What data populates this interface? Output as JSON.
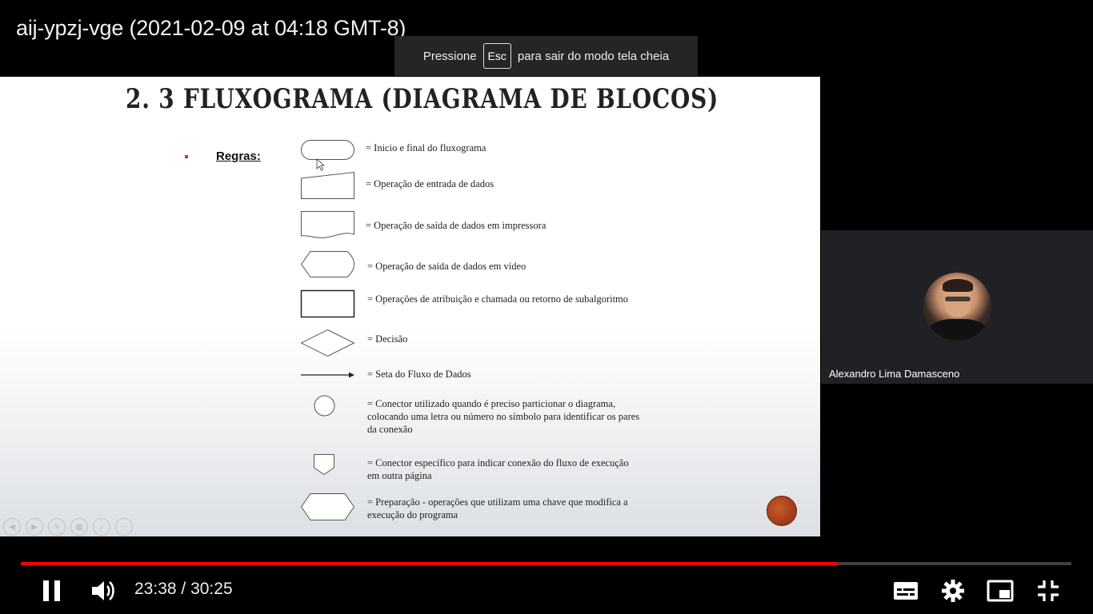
{
  "video": {
    "title": "aij-ypzj-vge (2021-02-09 at 04:18 GMT-8)"
  },
  "fullscreen_toast": {
    "prefix": "Pressione",
    "key": "Esc",
    "suffix": "para sair do modo tela cheia"
  },
  "slide": {
    "title": "2. 3 FLUXOGRAMA (DIAGRAMA DE BLOCOS)",
    "rules_label": "Regras:",
    "legend": [
      {
        "icon": "terminator-shape-icon",
        "text": "= Inicio e final do fluxograma"
      },
      {
        "icon": "manual-input-shape-icon",
        "text": "= Operação de entrada de dados"
      },
      {
        "icon": "document-shape-icon",
        "text": "= Operação de saída de dados em impressora"
      },
      {
        "icon": "display-shape-icon",
        "text": "= Operação de saída de dados em vídeo"
      },
      {
        "icon": "process-shape-icon",
        "text": "= Operações de atribuição e chamada ou  retorno de subalgoritmo"
      },
      {
        "icon": "decision-shape-icon",
        "text": "= Decisão"
      },
      {
        "icon": "arrow-shape-icon",
        "text": "= Seta do Fluxo de Dados"
      },
      {
        "icon": "connector-shape-icon",
        "text_lines": [
          "= Conector utilizado quando é preciso particionar o diagrama,",
          "colocando uma letra ou número no símbolo para identificar os pares",
          "da conexão"
        ]
      },
      {
        "icon": "offpage-connector-shape-icon",
        "text_lines": [
          "= Conector específico para indicar conexão do fluxo de execução",
          "em outra página"
        ]
      },
      {
        "icon": "preparation-shape-icon",
        "text_lines": [
          "= Preparação - operações que utilizam uma chave que modifica a",
          "execução do programa"
        ]
      }
    ]
  },
  "participant": {
    "name": "Alexandro Lima Damasceno"
  },
  "player": {
    "current_time": "23:38",
    "separator": " / ",
    "duration": "30:25",
    "progress_fraction": 0.777,
    "progress_color": "#ff0000",
    "icons": {
      "play_pause": "pause-icon",
      "volume": "volume-icon",
      "captions": "subtitles-icon",
      "settings": "gear-icon",
      "miniplayer": "miniplayer-icon",
      "fullscreen": "exit-fullscreen-icon"
    }
  }
}
